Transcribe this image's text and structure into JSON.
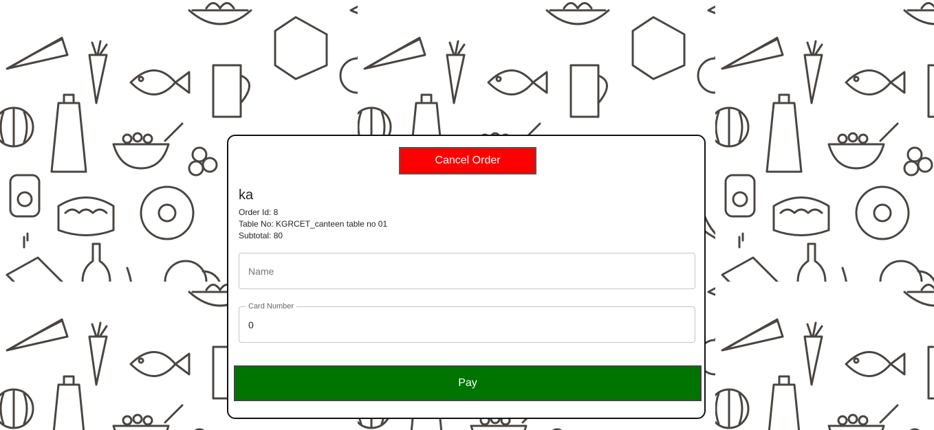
{
  "background": {
    "pattern": "food-doodle-icons",
    "stroke_color": "#4a4540"
  },
  "order_dialog": {
    "cancel_label": "Cancel Order",
    "customer_name": "ka",
    "order_id_text": "Order Id: 8",
    "table_no_text": "Table No: KGRCET_canteen table no 01",
    "subtotal_text": "Subtotal: 80",
    "name_field": {
      "placeholder": "Name",
      "value": ""
    },
    "card_field": {
      "label": "Card Number",
      "value": "0"
    },
    "pay_label": "Pay"
  },
  "colors": {
    "cancel": "#ff0000",
    "pay": "#007400"
  }
}
